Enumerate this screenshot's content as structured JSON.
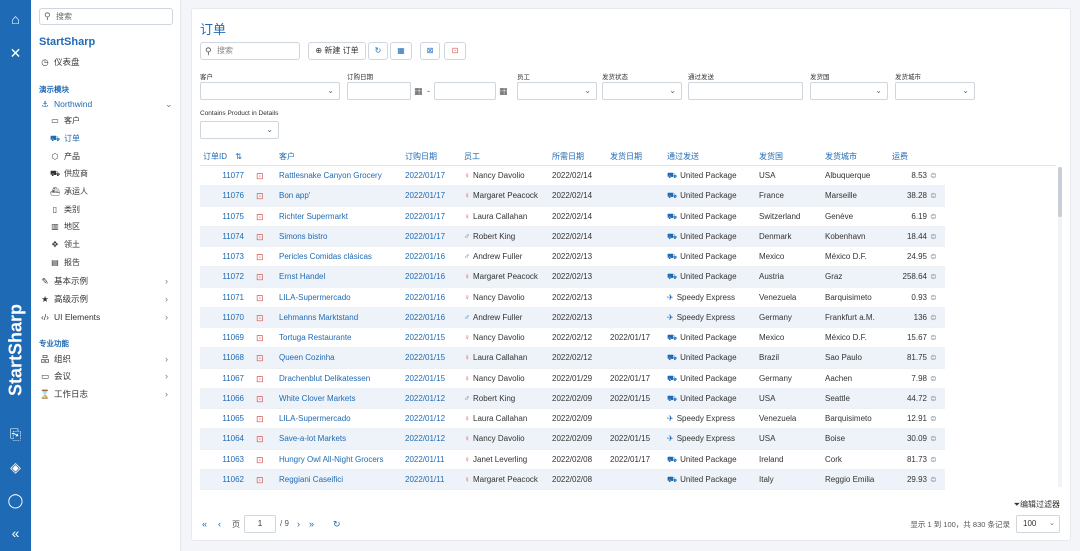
{
  "rail": {
    "brand": "StartSharp"
  },
  "sidebar": {
    "search_placeholder": "搜索",
    "brand": "StartSharp",
    "dashboard": "仪表盘",
    "section_demo": "演示模块",
    "northwind": "Northwind",
    "northwind_items": [
      "客户",
      "订单",
      "产品",
      "供应商",
      "承运人",
      "类别",
      "地区",
      "领土",
      "报告"
    ],
    "basic_samples": "基本示例",
    "advanced_samples": "高级示例",
    "ui_elements": "UI Elements",
    "section_pro": "专业功能",
    "organization": "组织",
    "meeting": "会议",
    "worklog": "工作日志"
  },
  "main": {
    "title": "订单",
    "search_placeholder": "搜索",
    "new_order": "新建 订单",
    "filters": {
      "customer": "客户",
      "order_date": "订购日期",
      "employee": "员工",
      "ship_status": "发货状态",
      "ship_via": "通过发送",
      "ship_country": "发货国",
      "ship_city": "发货城市",
      "contains_product": "Contains Product in Details",
      "date_sep": "-"
    },
    "columns": {
      "id": "订单ID",
      "customer": "客户",
      "order_date": "订购日期",
      "employee": "员工",
      "required_date": "所需日期",
      "shipped_date": "发货日期",
      "ship_via": "通过发送",
      "ship_country": "发货国",
      "ship_city": "发货城市",
      "freight": "运费"
    },
    "rows": [
      {
        "id": "11077",
        "customer": "Rattlesnake Canyon Grocery",
        "order_date": "2022/01/17",
        "employee": "Nancy Davolio",
        "gender": "f",
        "required": "2022/02/14",
        "shipped": "",
        "via": "United Package",
        "via_icon": "truck",
        "country": "USA",
        "city": "Albuquerque",
        "freight": "8.53"
      },
      {
        "id": "11076",
        "customer": "Bon app'",
        "order_date": "2022/01/17",
        "employee": "Margaret Peacock",
        "gender": "f",
        "required": "2022/02/14",
        "shipped": "",
        "via": "United Package",
        "via_icon": "truck",
        "country": "France",
        "city": "Marseille",
        "freight": "38.28"
      },
      {
        "id": "11075",
        "customer": "Richter Supermarkt",
        "order_date": "2022/01/17",
        "employee": "Laura Callahan",
        "gender": "f",
        "required": "2022/02/14",
        "shipped": "",
        "via": "United Package",
        "via_icon": "truck",
        "country": "Switzerland",
        "city": "Genève",
        "freight": "6.19"
      },
      {
        "id": "11074",
        "customer": "Simons bistro",
        "order_date": "2022/01/17",
        "employee": "Robert King",
        "gender": "m",
        "required": "2022/02/14",
        "shipped": "",
        "via": "United Package",
        "via_icon": "truck",
        "country": "Denmark",
        "city": "Kobenhavn",
        "freight": "18.44"
      },
      {
        "id": "11073",
        "customer": "Pericles Comidas clásicas",
        "order_date": "2022/01/16",
        "employee": "Andrew Fuller",
        "gender": "m",
        "required": "2022/02/13",
        "shipped": "",
        "via": "United Package",
        "via_icon": "truck",
        "country": "Mexico",
        "city": "México D.F.",
        "freight": "24.95"
      },
      {
        "id": "11072",
        "customer": "Ernst Handel",
        "order_date": "2022/01/16",
        "employee": "Margaret Peacock",
        "gender": "f",
        "required": "2022/02/13",
        "shipped": "",
        "via": "United Package",
        "via_icon": "truck",
        "country": "Austria",
        "city": "Graz",
        "freight": "258.64"
      },
      {
        "id": "11071",
        "customer": "LILA-Supermercado",
        "order_date": "2022/01/16",
        "employee": "Nancy Davolio",
        "gender": "f",
        "required": "2022/02/13",
        "shipped": "",
        "via": "Speedy Express",
        "via_icon": "plane",
        "country": "Venezuela",
        "city": "Barquisimeto",
        "freight": "0.93"
      },
      {
        "id": "11070",
        "customer": "Lehmanns Marktstand",
        "order_date": "2022/01/16",
        "employee": "Andrew Fuller",
        "gender": "m",
        "required": "2022/02/13",
        "shipped": "",
        "via": "Speedy Express",
        "via_icon": "plane",
        "country": "Germany",
        "city": "Frankfurt a.M.",
        "freight": "136"
      },
      {
        "id": "11069",
        "customer": "Tortuga Restaurante",
        "order_date": "2022/01/15",
        "employee": "Nancy Davolio",
        "gender": "f",
        "required": "2022/02/12",
        "shipped": "2022/01/17",
        "via": "United Package",
        "via_icon": "truck",
        "country": "Mexico",
        "city": "México D.F.",
        "freight": "15.67"
      },
      {
        "id": "11068",
        "customer": "Queen Cozinha",
        "order_date": "2022/01/15",
        "employee": "Laura Callahan",
        "gender": "f",
        "required": "2022/02/12",
        "shipped": "",
        "via": "United Package",
        "via_icon": "truck",
        "country": "Brazil",
        "city": "Sao Paulo",
        "freight": "81.75"
      },
      {
        "id": "11067",
        "customer": "Drachenblut Delikatessen",
        "order_date": "2022/01/15",
        "employee": "Nancy Davolio",
        "gender": "f",
        "required": "2022/01/29",
        "shipped": "2022/01/17",
        "via": "United Package",
        "via_icon": "truck",
        "country": "Germany",
        "city": "Aachen",
        "freight": "7.98"
      },
      {
        "id": "11066",
        "customer": "White Clover Markets",
        "order_date": "2022/01/12",
        "employee": "Robert King",
        "gender": "m",
        "required": "2022/02/09",
        "shipped": "2022/01/15",
        "via": "United Package",
        "via_icon": "truck",
        "country": "USA",
        "city": "Seattle",
        "freight": "44.72"
      },
      {
        "id": "11065",
        "customer": "LILA-Supermercado",
        "order_date": "2022/01/12",
        "employee": "Laura Callahan",
        "gender": "f",
        "required": "2022/02/09",
        "shipped": "",
        "via": "Speedy Express",
        "via_icon": "plane",
        "country": "Venezuela",
        "city": "Barquisimeto",
        "freight": "12.91"
      },
      {
        "id": "11064",
        "customer": "Save-a-lot Markets",
        "order_date": "2022/01/12",
        "employee": "Nancy Davolio",
        "gender": "f",
        "required": "2022/02/09",
        "shipped": "2022/01/15",
        "via": "Speedy Express",
        "via_icon": "plane",
        "country": "USA",
        "city": "Boise",
        "freight": "30.09"
      },
      {
        "id": "11063",
        "customer": "Hungry Owl All-Night Grocers",
        "order_date": "2022/01/11",
        "employee": "Janet Leverling",
        "gender": "f",
        "required": "2022/02/08",
        "shipped": "2022/01/17",
        "via": "United Package",
        "via_icon": "truck",
        "country": "Ireland",
        "city": "Cork",
        "freight": "81.73"
      },
      {
        "id": "11062",
        "customer": "Reggiani Caseifici",
        "order_date": "2022/01/11",
        "employee": "Margaret Peacock",
        "gender": "f",
        "required": "2022/02/08",
        "shipped": "",
        "via": "United Package",
        "via_icon": "truck",
        "country": "Italy",
        "city": "Reggio Emilia",
        "freight": "29.93"
      }
    ],
    "edit_filter": "编辑过滤器",
    "pager": {
      "page_label": "页",
      "page_value": "1",
      "total_pages": "/ 9",
      "record_info": "显示 1 到 100，共 830 条记录",
      "page_size": "100"
    }
  }
}
